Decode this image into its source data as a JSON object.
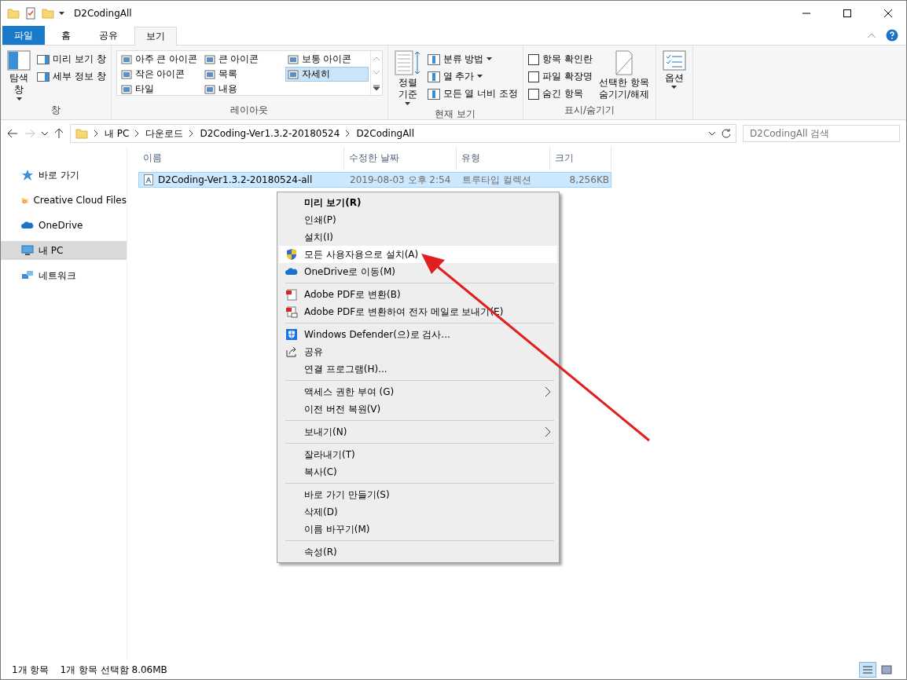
{
  "window": {
    "title": "D2CodingAll"
  },
  "tabs": [
    {
      "label": "파일",
      "kind": "file",
      "selected": false
    },
    {
      "label": "홈",
      "kind": "tab",
      "selected": false
    },
    {
      "label": "공유",
      "kind": "tab",
      "selected": false
    },
    {
      "label": "보기",
      "kind": "tab",
      "selected": true
    }
  ],
  "ribbon": {
    "pane_group": {
      "label": "창",
      "big_button": "탐색\n창",
      "items": [
        "미리 보기 창",
        "세부 정보 창"
      ]
    },
    "layout_group": {
      "label": "레이아웃",
      "items": [
        {
          "label": "아주 큰 아이콘",
          "selected": false
        },
        {
          "label": "큰 아이콘",
          "selected": false
        },
        {
          "label": "보통 아이콘",
          "selected": false
        },
        {
          "label": "작은 아이콘",
          "selected": false
        },
        {
          "label": "목록",
          "selected": false
        },
        {
          "label": "자세히",
          "selected": true
        },
        {
          "label": "타일",
          "selected": false
        },
        {
          "label": "내용",
          "selected": false
        }
      ]
    },
    "view_group": {
      "label": "현재 보기",
      "big_button": "정렬\n기준",
      "items": [
        {
          "label": "분류 방법",
          "dropdown": true
        },
        {
          "label": "열 추가",
          "dropdown": true
        },
        {
          "label": "모든 열 너비 조정",
          "dropdown": false
        }
      ]
    },
    "show_group": {
      "label": "표시/숨기기",
      "checkboxes": [
        {
          "label": "항목 확인란",
          "checked": false
        },
        {
          "label": "파일 확장명",
          "checked": false
        },
        {
          "label": "숨긴 항목",
          "checked": false
        }
      ],
      "big_button": "선택한 항목\n숨기기/해제"
    },
    "options": {
      "label": "옵션"
    }
  },
  "address": {
    "path": [
      "내 PC",
      "다운로드",
      "D2Coding-Ver1.3.2-20180524",
      "D2CodingAll"
    ],
    "search_placeholder": "D2CodingAll 검색"
  },
  "sidebar": {
    "items": [
      {
        "label": "바로 가기",
        "kind": "star",
        "selected": false
      },
      {
        "label": "Creative Cloud Files",
        "kind": "cc",
        "selected": false
      },
      {
        "label": "OneDrive",
        "kind": "cloud",
        "selected": false
      },
      {
        "label": "내 PC",
        "kind": "pc",
        "selected": true
      },
      {
        "label": "네트워크",
        "kind": "network",
        "selected": false
      }
    ]
  },
  "table": {
    "columns": [
      "이름",
      "수정한 날짜",
      "유형",
      "크기"
    ],
    "rows": [
      {
        "name": "D2Coding-Ver1.3.2-20180524-all",
        "date": "2019-08-03 오후 2:54",
        "type": "트루타입 컬렉션",
        "size": "8,256KB",
        "selected": true
      }
    ]
  },
  "context_menu": [
    {
      "kind": "plain",
      "label": "미리 보기(R)",
      "default": true,
      "selected": false
    },
    {
      "kind": "plain",
      "label": "인쇄(P)",
      "selected": false
    },
    {
      "kind": "plain",
      "label": "설치(I)",
      "selected": false
    },
    {
      "kind": "shield",
      "label": "모든 사용자용으로 설치(A)",
      "selected": true
    },
    {
      "kind": "cloud",
      "label": "OneDrive로 이동(M)",
      "selected": false
    },
    {
      "kind": "separator"
    },
    {
      "kind": "pdf",
      "label": "Adobe PDF로 변환(B)",
      "selected": false
    },
    {
      "kind": "pdfmail",
      "label": "Adobe PDF로 변환하여 전자 메일로 보내기(E)",
      "selected": false
    },
    {
      "kind": "separator"
    },
    {
      "kind": "defender",
      "label": "Windows Defender(으)로 검사...",
      "selected": false
    },
    {
      "kind": "share",
      "label": "공유",
      "selected": false
    },
    {
      "kind": "plain",
      "label": "연결 프로그램(H)...",
      "selected": false
    },
    {
      "kind": "separator"
    },
    {
      "kind": "plain",
      "label": "액세스 권한 부여 (G)",
      "submenu": true,
      "selected": false
    },
    {
      "kind": "plain",
      "label": "이전 버전 복원(V)",
      "selected": false
    },
    {
      "kind": "separator"
    },
    {
      "kind": "plain",
      "label": "보내기(N)",
      "submenu": true,
      "selected": false
    },
    {
      "kind": "separator"
    },
    {
      "kind": "plain",
      "label": "잘라내기(T)",
      "selected": false
    },
    {
      "kind": "plain",
      "label": "복사(C)",
      "selected": false
    },
    {
      "kind": "separator"
    },
    {
      "kind": "plain",
      "label": "바로 가기 만들기(S)",
      "selected": false
    },
    {
      "kind": "plain",
      "label": "삭제(D)",
      "selected": false
    },
    {
      "kind": "plain",
      "label": "이름 바꾸기(M)",
      "selected": false
    },
    {
      "kind": "separator"
    },
    {
      "kind": "plain",
      "label": "속성(R)",
      "selected": false
    }
  ],
  "status_bar": {
    "count": "1개 항목",
    "selection": "1개 항목 선택함 8.06MB",
    "views": [
      {
        "kind": "details",
        "selected": true
      },
      {
        "kind": "thumbs",
        "selected": false
      }
    ]
  }
}
